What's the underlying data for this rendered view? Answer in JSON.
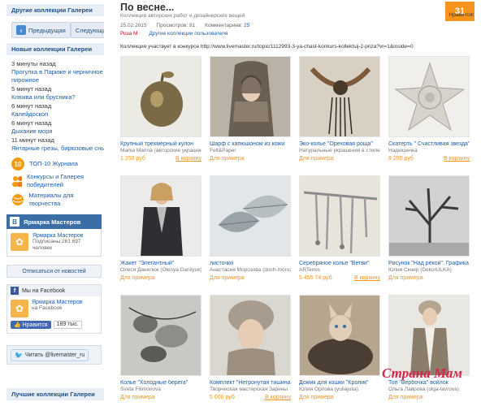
{
  "sidebar": {
    "other_collections": "Другие коллекции Галереи",
    "prev": "Предыдущая",
    "next": "Следующая",
    "new_collections": "Новые коллекции Галереи",
    "news": [
      {
        "time": "3 минуты назад",
        "link": "Прогулка в Париже и черничное пирожное"
      },
      {
        "time": "5 минут назад",
        "link": "Клюква или брусника?"
      },
      {
        "time": "6 минут назад",
        "link": "Калейдоскоп"
      },
      {
        "time": "6 минут назад",
        "link": "Дыхание моря"
      },
      {
        "time": "11 минут назад",
        "link": "Янтарные грезы, бирюзовые сны ..."
      }
    ],
    "promos": [
      {
        "icon": "10",
        "text": "ТОП-10 Журнала"
      },
      {
        "icon": "people",
        "text": "Конкурсы и Галерея победителей"
      },
      {
        "icon": "ball",
        "text": "Материалы для творчества"
      }
    ],
    "vk_title": "Ярмарка Мастеров",
    "vk_name": "Ярмарка Мастеров",
    "vk_sub1": "Подписаны 261 697",
    "vk_sub2": "человек",
    "unsubscribe": "Отписаться от новостей",
    "fb_title": "Мы на Facebook",
    "fb_name": "Ярмарка Мастеров",
    "fb_sub": "на Facebook",
    "fb_like": "Нравится",
    "fb_count": "189 тыс.",
    "tw_label": "Читать @livemaster_ru",
    "best": "Лучшие коллекции Галереи"
  },
  "main": {
    "title": "По весне...",
    "subtitle": "Коллекция авторских работ и дизайнерских вещей",
    "date": "25.02.2015",
    "views_label": "Просмотров:",
    "views": "91",
    "comments_label": "Комментариев:",
    "comments": "25",
    "author": "Роза М",
    "other_author": "Другие коллекции пользователя",
    "contest": "Коллекция участвует в конкурсе http://www.livemaster.ru/topic/1112993-3-ya-chast-konkurs-kollektsij-2-priza?vr=1&inside=0",
    "like_count": "31",
    "like_label": "Нравится!"
  },
  "items": [
    {
      "caption": "Крупный трехмерный кулон",
      "seller": "Marka Marina (авторские украшения)",
      "price": "1 250 руб",
      "action": "В корзину",
      "art": "apple"
    },
    {
      "caption": "Шарф с капюшоном из кожи",
      "seller": "Felt&Paper",
      "price": "Для примера",
      "action": "",
      "art": "scarf"
    },
    {
      "caption": "Эко-колье \"Ореховая роща\"",
      "seller": "Натуральные украшения в стиле бохо",
      "price": "Для примера",
      "action": "",
      "art": "necklace"
    },
    {
      "caption": "Скатерть \" Счастливая звезда\"",
      "seller": "Надюшечка",
      "price": "8 250 руб",
      "action": "В корзину",
      "art": "lace"
    },
    {
      "caption": "Жакет \"Элегантный\"",
      "seller": "Олеся Данилюк (Olesya Danilyuk)",
      "price": "Для примера",
      "action": "",
      "art": "jacket"
    },
    {
      "caption": "листочки",
      "seller": "Анастасия Морозова (doch-moroza)",
      "price": "Для примера",
      "action": "",
      "art": "leaves"
    },
    {
      "caption": "Серебряное колье \"Ветви\"",
      "seller": "ARTemis",
      "price": "5 455 74 руб",
      "action": "В корзину",
      "art": "branches"
    },
    {
      "caption": "Рисунок \"Над рекой\". Графика",
      "seller": "Юлия Скнир (DekorULKA)",
      "price": "Для примера",
      "action": "",
      "art": "tree"
    },
    {
      "caption": "Колье \"Холодные берега\"",
      "seller": "Sveta Filimonova",
      "price": "Для примера",
      "action": "",
      "art": "stones"
    },
    {
      "caption": "Комплект \"Нетронутая тишина\"",
      "seller": "Творческая мастерская Зарины",
      "price": "5 000 руб",
      "action": "В корзину",
      "art": "hat"
    },
    {
      "caption": "Домик для кошки \"Кролик\"",
      "seller": "Юлия Орлова (yuliajulia)",
      "price": "Для примера",
      "action": "",
      "art": "cat"
    },
    {
      "caption": "Топ \"Вербочка\" войлок",
      "seller": "Ольга Лаврова (olga-lavrova)",
      "price": "Для примера",
      "action": "",
      "art": "top"
    }
  ],
  "watermark": "Страна Мам"
}
